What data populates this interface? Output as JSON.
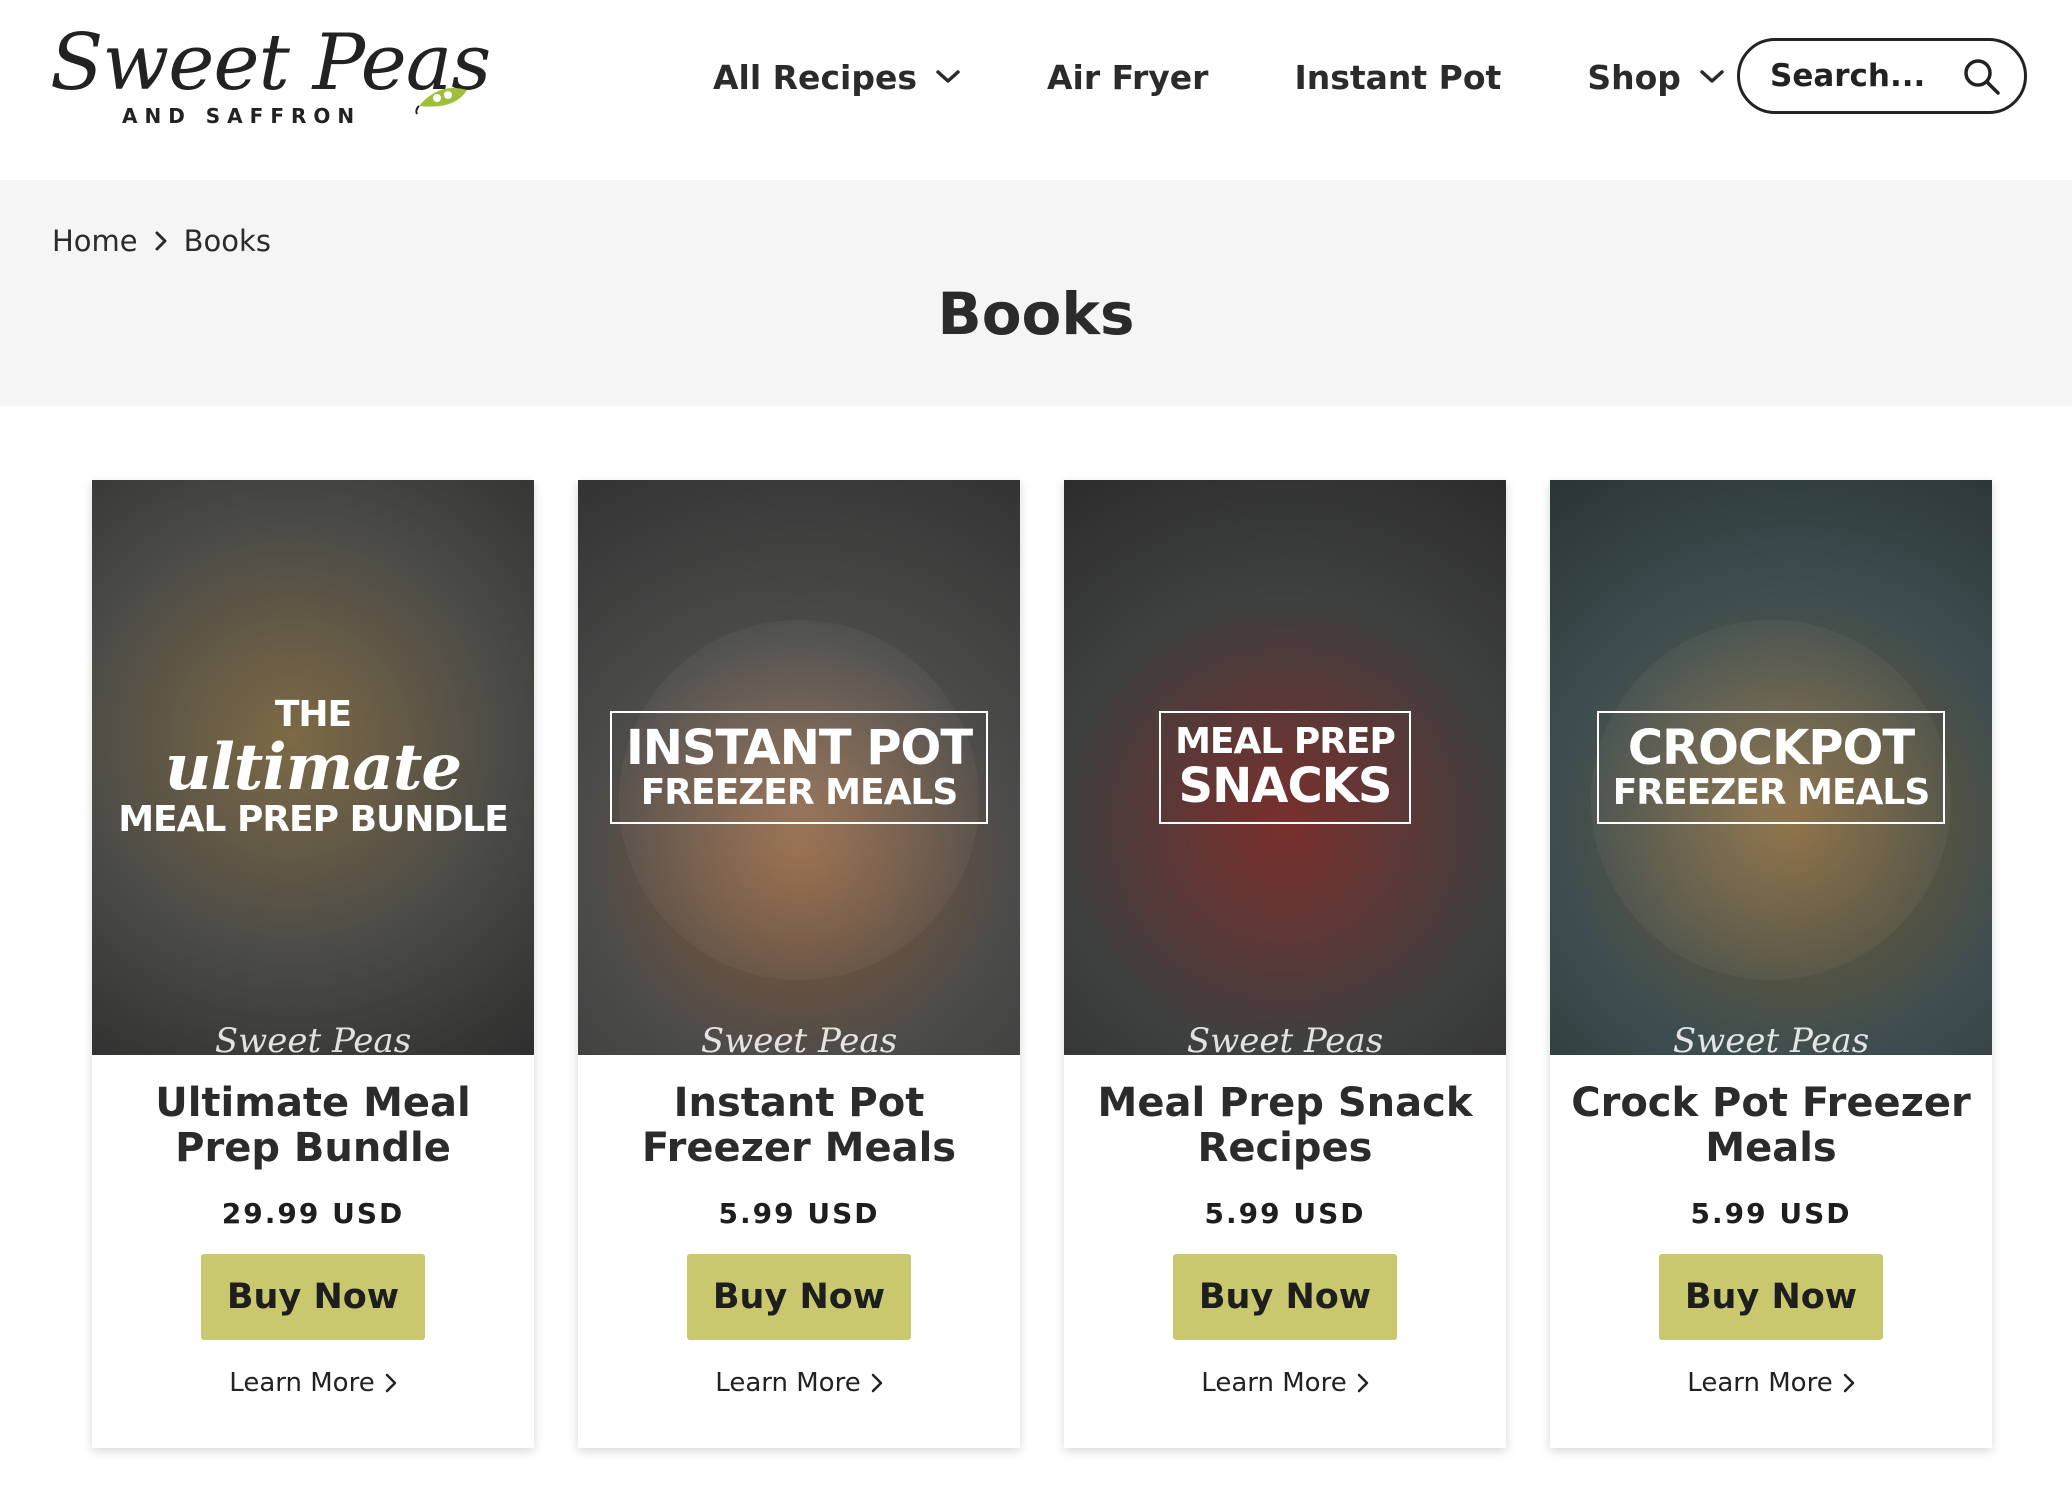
{
  "brand": {
    "logo_script": "Sweet Peas",
    "logo_sub": "AND SAFFRON",
    "accent_color": "#9fbf3b"
  },
  "nav": {
    "items": [
      {
        "label": "All Recipes",
        "has_dropdown": true
      },
      {
        "label": "Air Fryer",
        "has_dropdown": false
      },
      {
        "label": "Instant Pot",
        "has_dropdown": false
      },
      {
        "label": "Shop",
        "has_dropdown": true
      }
    ],
    "search_placeholder": "Search...",
    "search_icon": "search-icon"
  },
  "breadcrumb": {
    "home": "Home",
    "current": "Books"
  },
  "page_title": "Books",
  "colors": {
    "button_bg": "#c9c86f",
    "band_bg": "#f5f5f5"
  },
  "products": [
    {
      "cover_lines": [
        "THE",
        "ultimate",
        "MEAL PREP BUNDLE"
      ],
      "cover_brand": "Sweet Peas",
      "title": "Ultimate Meal Prep Bundle",
      "price": "29.99 USD",
      "buy_label": "Buy Now",
      "learn_label": "Learn More"
    },
    {
      "cover_lines": [
        "INSTANT POT",
        "FREEZER MEALS"
      ],
      "cover_brand": "Sweet Peas",
      "title": "Instant Pot Freezer Meals",
      "price": "5.99 USD",
      "buy_label": "Buy Now",
      "learn_label": "Learn More"
    },
    {
      "cover_lines": [
        "MEAL PREP",
        "SNACKS"
      ],
      "cover_brand": "Sweet Peas",
      "title": "Meal Prep Snack Recipes",
      "price": "5.99 USD",
      "buy_label": "Buy Now",
      "learn_label": "Learn More"
    },
    {
      "cover_lines": [
        "CROCKPOT",
        "FREEZER MEALS"
      ],
      "cover_brand": "Sweet Peas",
      "title": "Crock Pot Freezer Meals",
      "price": "5.99 USD",
      "buy_label": "Buy Now",
      "learn_label": "Learn More"
    }
  ]
}
